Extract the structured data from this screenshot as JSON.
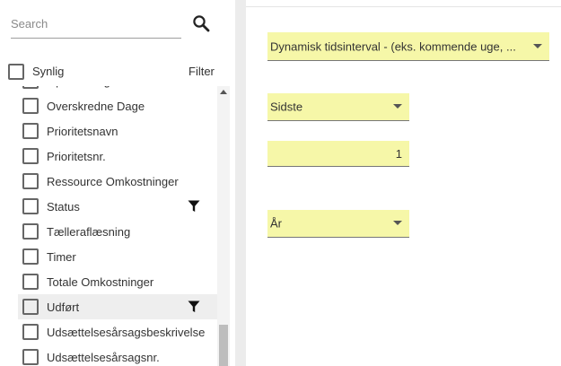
{
  "search": {
    "placeholder": "Search"
  },
  "header": {
    "visible_label": "Synlig",
    "filter_label": "Filter"
  },
  "list": {
    "items": [
      {
        "label": "Opstartsdage",
        "filtered": false
      },
      {
        "label": "Overskredne Dage",
        "filtered": false
      },
      {
        "label": "Prioritetsnavn",
        "filtered": false
      },
      {
        "label": "Prioritetsnr.",
        "filtered": false
      },
      {
        "label": "Ressource Omkostninger",
        "filtered": false
      },
      {
        "label": "Status",
        "filtered": true
      },
      {
        "label": "Tælleraflæsning",
        "filtered": false
      },
      {
        "label": "Timer",
        "filtered": false
      },
      {
        "label": "Totale Omkostninger",
        "filtered": false
      },
      {
        "label": "Udført",
        "filtered": true,
        "selected": true
      },
      {
        "label": "Udsættelsesårsagsbeskrivelse",
        "filtered": false
      },
      {
        "label": "Udsættelsesårsagsnr.",
        "filtered": false
      }
    ]
  },
  "filter_panel": {
    "interval_type": "Dynamisk tidsinterval - (eks. kommende uge, ...",
    "direction": "Sidste",
    "count": "1",
    "unit": "År"
  },
  "colors": {
    "field_bg": "#f6f7a8",
    "divider": "#ececec",
    "selected_row": "#eeeeee"
  }
}
